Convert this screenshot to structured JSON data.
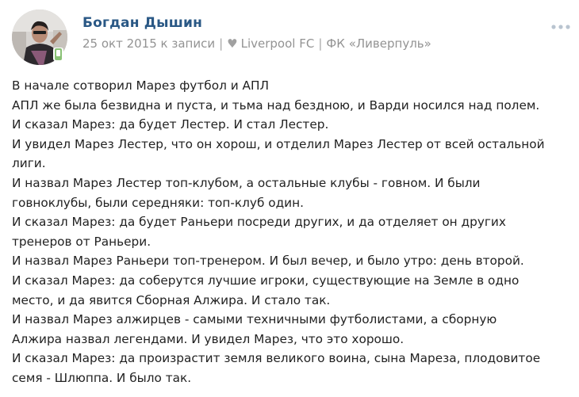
{
  "author": {
    "name": "Богдан Дышин",
    "online_icon": "mobile-phone-icon"
  },
  "meta": {
    "date": "25 окт 2015 к записи",
    "separator": "|",
    "heart_icon": "heart-icon",
    "heart_glyph": "♥",
    "club_en": "Liverpool FC",
    "club_ru": "ФК «Ливерпуль»"
  },
  "actions": {
    "more_icon": "more-dots-icon"
  },
  "post": {
    "lines": [
      "В начале сотворил Марез футбол и АПЛ",
      "АПЛ же была безвидна и пуста, и тьма над бездною, и Варди носился над полем.",
      "И сказал Марез: да будет Лестер. И стал Лестер.",
      "И увидел Марез Лестер, что он хорош, и отделил Марез Лестер от всей остальной",
      "лиги.",
      "И назвал Марез Лестер топ-клубом, а остальные клубы - говном. И были",
      "говноклубы, были середняки: топ-клуб один.",
      "И сказал Марез: да будет Раньери посреди других, и да отделяет он других",
      "тренеров от Раньери.",
      "И назвал Марез Раньери топ-тренером. И был вечер, и было утро: день второй.",
      "И сказал Марез: да соберутся лучшие игроки, существующие на Земле в одно",
      "место, и да явится Сборная Алжира. И стало так.",
      "И назвал Марез алжирцев - самыми техничными футболистами, а сборную",
      "Алжира назвал легендами. И увидел Марез, что это хорошо.",
      "И сказал Марез: да произрастит земля великого воина, сына Мареза, плодовитое",
      "семя - Шлюппа. И было так."
    ]
  },
  "colors": {
    "name_link": "#2a5885",
    "meta_text": "#939393",
    "body_text": "#222222",
    "online_badge": "#8ac176"
  }
}
